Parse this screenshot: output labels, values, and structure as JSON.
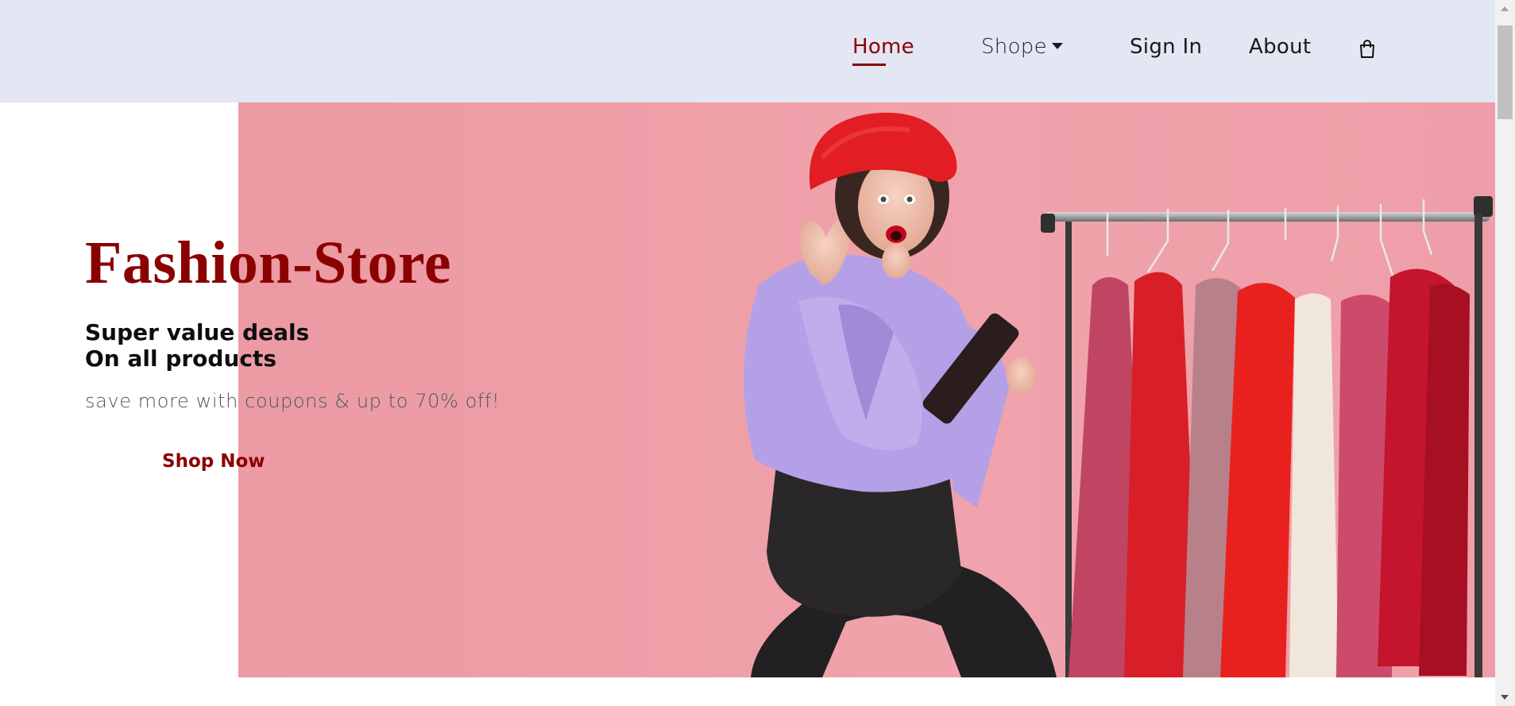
{
  "nav": {
    "items": [
      {
        "label": "Home",
        "active": true
      },
      {
        "label": "Shope",
        "has_dropdown": true
      },
      {
        "label": "Sign In"
      },
      {
        "label": "About"
      }
    ],
    "cart_icon": "shopping-bag-icon"
  },
  "hero": {
    "title": "Fashion-Store",
    "subtitle_line1": "Super value deals",
    "subtitle_line2": "On all products",
    "note": "save more with coupons & up to 70% off!",
    "button_label": "Shop Now"
  },
  "colors": {
    "header_bg": "#e3e6f3",
    "brand": "#8b0000",
    "hero_bg": "#ee9fa8",
    "note_text": "#465b52"
  }
}
